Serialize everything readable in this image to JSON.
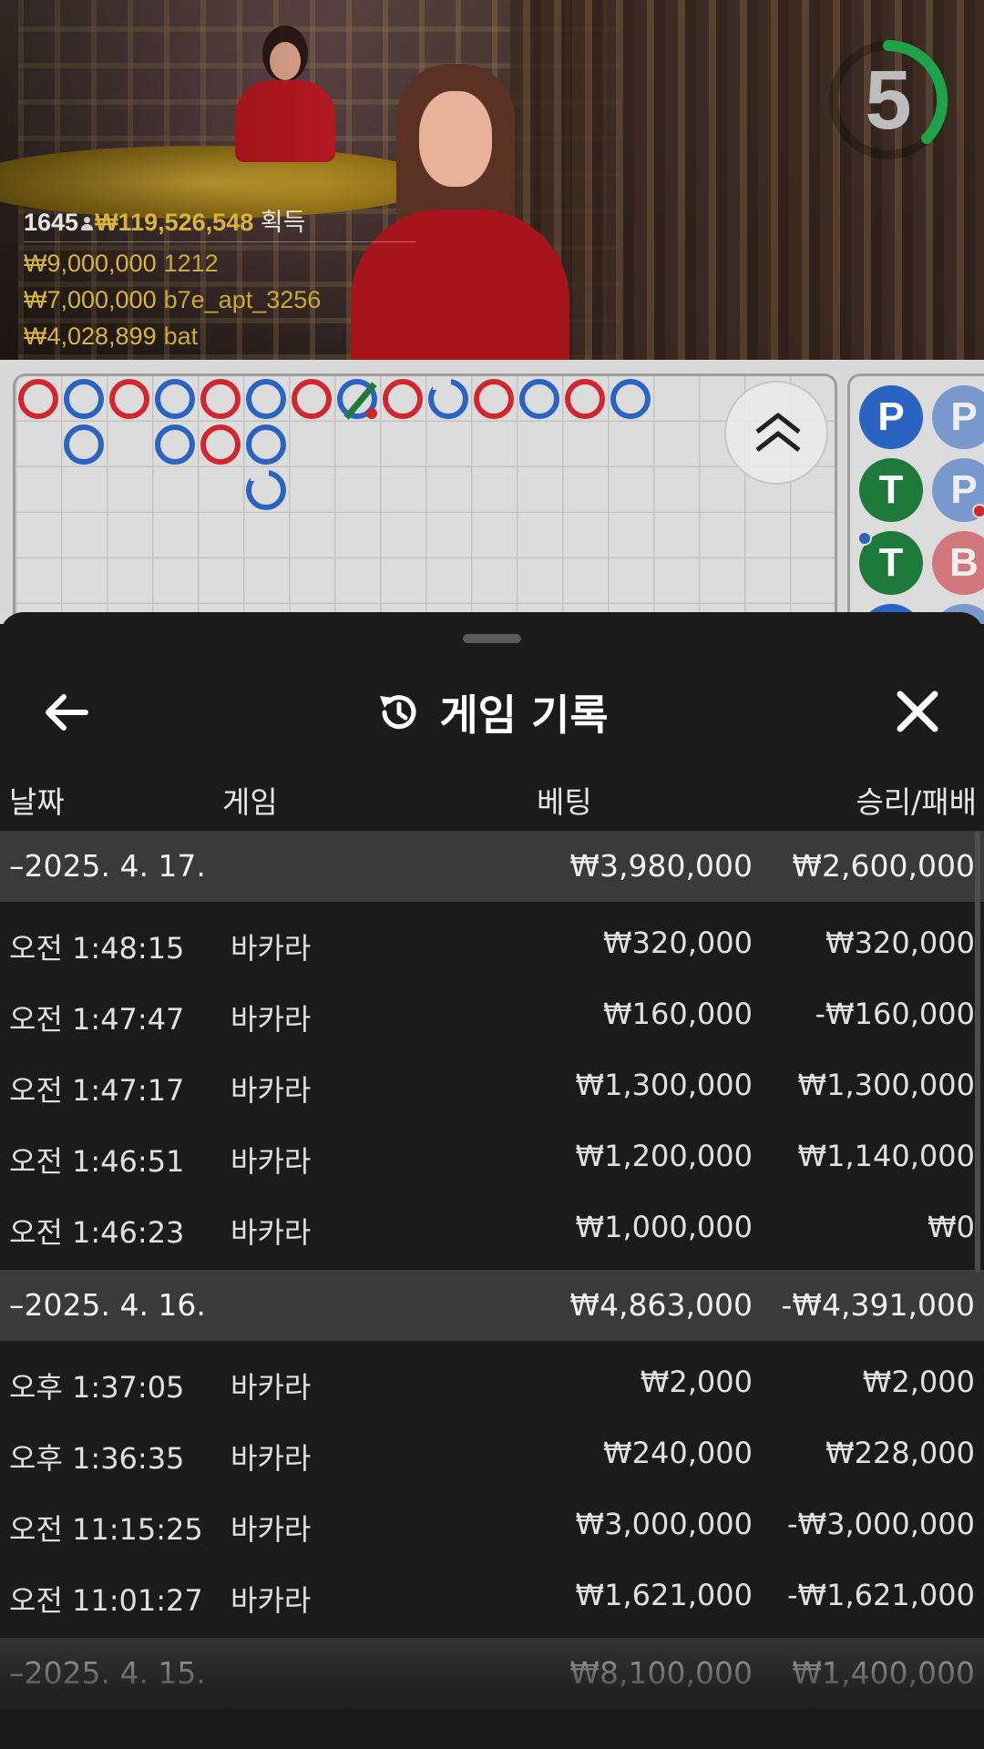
{
  "overlay": {
    "players": "1645",
    "total_win": "₩119,526,548",
    "total_win_label": "획득",
    "winners": [
      {
        "amount": "₩9,000,000",
        "user": "1212"
      },
      {
        "amount": "₩7,000,000",
        "user": "b7e_apt_3256"
      },
      {
        "amount": "₩4,028,899",
        "user": "bat"
      }
    ],
    "countdown": "5"
  },
  "colors": {
    "banker": "#d0272f",
    "player": "#2a63c2",
    "tie": "#1d7a3a",
    "gold": "#d9b43c"
  },
  "bigroad": {
    "columns": [
      [
        "B"
      ],
      [
        "P",
        "P"
      ],
      [
        "B"
      ],
      [
        "P",
        "P"
      ],
      [
        "B",
        "B"
      ],
      [
        "P",
        "P",
        "P"
      ],
      [
        "B"
      ],
      [
        "P-tie"
      ],
      [
        "B"
      ],
      [
        "P"
      ],
      [
        "B"
      ],
      [
        "P"
      ],
      [
        "B"
      ],
      [
        "P"
      ]
    ]
  },
  "beadroad": [
    "P",
    "P",
    "T",
    "P",
    "T",
    "B",
    "P",
    "P"
  ],
  "history": {
    "title": "게임 기록",
    "columns": {
      "date": "날짜",
      "game": "게임",
      "bet": "베팅",
      "win": "승리/패배"
    },
    "groups": [
      {
        "date": "–2025. 4. 17.",
        "bet": "₩3,980,000",
        "win": "₩2,600,000",
        "rows": [
          {
            "time": "오전 1:48:15",
            "game": "바카라",
            "bet": "₩320,000",
            "win": "₩320,000"
          },
          {
            "time": "오전 1:47:47",
            "game": "바카라",
            "bet": "₩160,000",
            "win": "-₩160,000"
          },
          {
            "time": "오전 1:47:17",
            "game": "바카라",
            "bet": "₩1,300,000",
            "win": "₩1,300,000"
          },
          {
            "time": "오전 1:46:51",
            "game": "바카라",
            "bet": "₩1,200,000",
            "win": "₩1,140,000"
          },
          {
            "time": "오전 1:46:23",
            "game": "바카라",
            "bet": "₩1,000,000",
            "win": "₩0"
          }
        ]
      },
      {
        "date": "–2025. 4. 16.",
        "bet": "₩4,863,000",
        "win": "-₩4,391,000",
        "rows": [
          {
            "time": "오후 1:37:05",
            "game": "바카라",
            "bet": "₩2,000",
            "win": "₩2,000"
          },
          {
            "time": "오후 1:36:35",
            "game": "바카라",
            "bet": "₩240,000",
            "win": "₩228,000"
          },
          {
            "time": "오전 11:15:25",
            "game": "바카라",
            "bet": "₩3,000,000",
            "win": "-₩3,000,000"
          },
          {
            "time": "오전 11:01:27",
            "game": "바카라",
            "bet": "₩1,621,000",
            "win": "-₩1,621,000"
          }
        ]
      },
      {
        "date": "–2025. 4. 15.",
        "bet": "₩8,100,000",
        "win": "₩1,400,000",
        "rows": []
      }
    ]
  }
}
